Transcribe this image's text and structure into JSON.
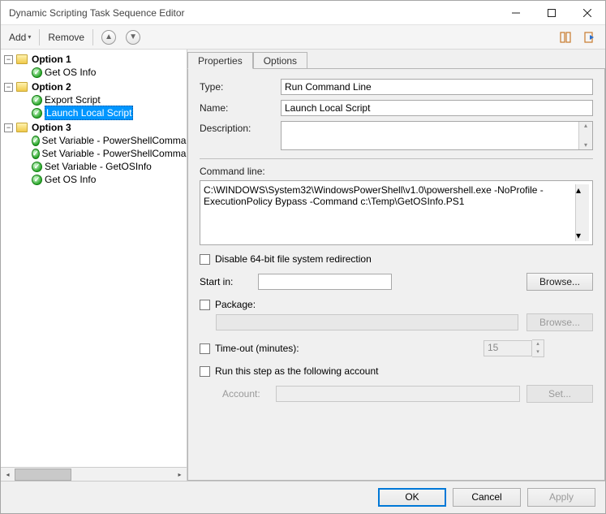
{
  "window": {
    "title": "Dynamic Scripting Task Sequence Editor"
  },
  "toolbar": {
    "add": "Add",
    "remove": "Remove"
  },
  "tree": {
    "groups": [
      {
        "label": "Option 1",
        "items": [
          "Get OS Info"
        ]
      },
      {
        "label": "Option 2",
        "items": [
          "Export Script",
          "Launch Local Script"
        ]
      },
      {
        "label": "Option 3",
        "items": [
          "Set Variable - PowerShellCommand",
          "Set Variable - PowerShellCommand",
          "Set Variable - GetOSInfo",
          "Get OS Info"
        ]
      }
    ],
    "selected": "Launch Local Script"
  },
  "tabs": {
    "properties": "Properties",
    "options": "Options"
  },
  "form": {
    "type_label": "Type:",
    "type_value": "Run Command Line",
    "name_label": "Name:",
    "name_value": "Launch Local Script",
    "desc_label": "Description:",
    "cmd_label": "Command line:",
    "cmd_value": "C:\\WINDOWS\\System32\\WindowsPowerShell\\v1.0\\powershell.exe -NoProfile -ExecutionPolicy Bypass -Command c:\\Temp\\GetOSInfo.PS1",
    "disable64": "Disable 64-bit file system redirection",
    "startin_label": "Start in:",
    "browse": "Browse...",
    "package": "Package:",
    "timeout": "Time-out (minutes):",
    "timeout_value": "15",
    "runas": "Run this step as the following account",
    "account_label": "Account:",
    "set": "Set..."
  },
  "buttons": {
    "ok": "OK",
    "cancel": "Cancel",
    "apply": "Apply"
  }
}
